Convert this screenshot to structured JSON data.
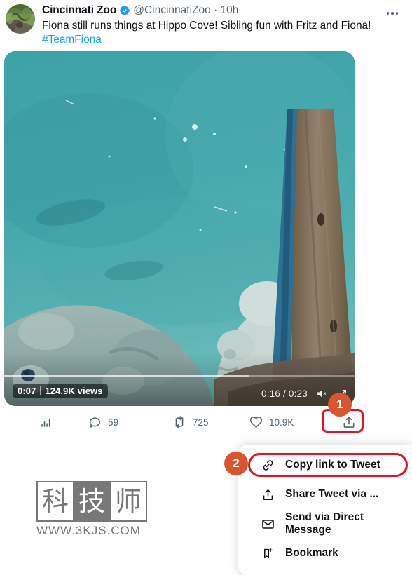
{
  "tweet": {
    "display_name": "Cincinnati Zoo",
    "verified_icon": "verified-badge-icon",
    "handle": "@CincinnatiZoo",
    "separator": "·",
    "timestamp": "10h",
    "more_icon": "more-options-icon",
    "text": "Fiona still runs things at Hippo Cove! Sibling fun with Fritz and Fiona!",
    "hashtag": "#TeamFiona",
    "avatar_alt": "avatar"
  },
  "video": {
    "elapsed_badge": "0:07",
    "views": "124.9K views",
    "time_display": "0:16 / 0:23",
    "mute_icon": "muted-speaker-icon",
    "fullscreen_icon": "expand-fullscreen-icon",
    "progress_percent": 70
  },
  "actions": {
    "analytics_icon": "analytics-bar-chart-icon",
    "analytics_count": "",
    "reply_icon": "reply-bubble-icon",
    "reply_count": "59",
    "retweet_icon": "retweet-icon",
    "retweet_count": "725",
    "like_icon": "heart-icon",
    "like_count": "10.9K",
    "share_icon": "share-upload-icon"
  },
  "annotations": {
    "step1": "1",
    "step2": "2",
    "highlight_color": "#e81123",
    "badge_color": "#d9552f"
  },
  "share_menu": {
    "items": [
      {
        "label": "Copy link to Tweet",
        "icon": "link-chain-icon"
      },
      {
        "label": "Share Tweet via ...",
        "icon": "share-upload-icon"
      },
      {
        "label": "Send via Direct Message",
        "icon": "envelope-icon"
      },
      {
        "label": "Bookmark",
        "icon": "bookmark-plus-icon"
      }
    ]
  },
  "watermark": {
    "char1": "科",
    "char2": "技",
    "char3": "师",
    "url": "WWW.3KJS.COM"
  },
  "colors": {
    "accent_blue": "#1d9bf0",
    "text_primary": "#0f1419",
    "text_secondary": "#536471",
    "water_teal": "#3aa0a6"
  }
}
